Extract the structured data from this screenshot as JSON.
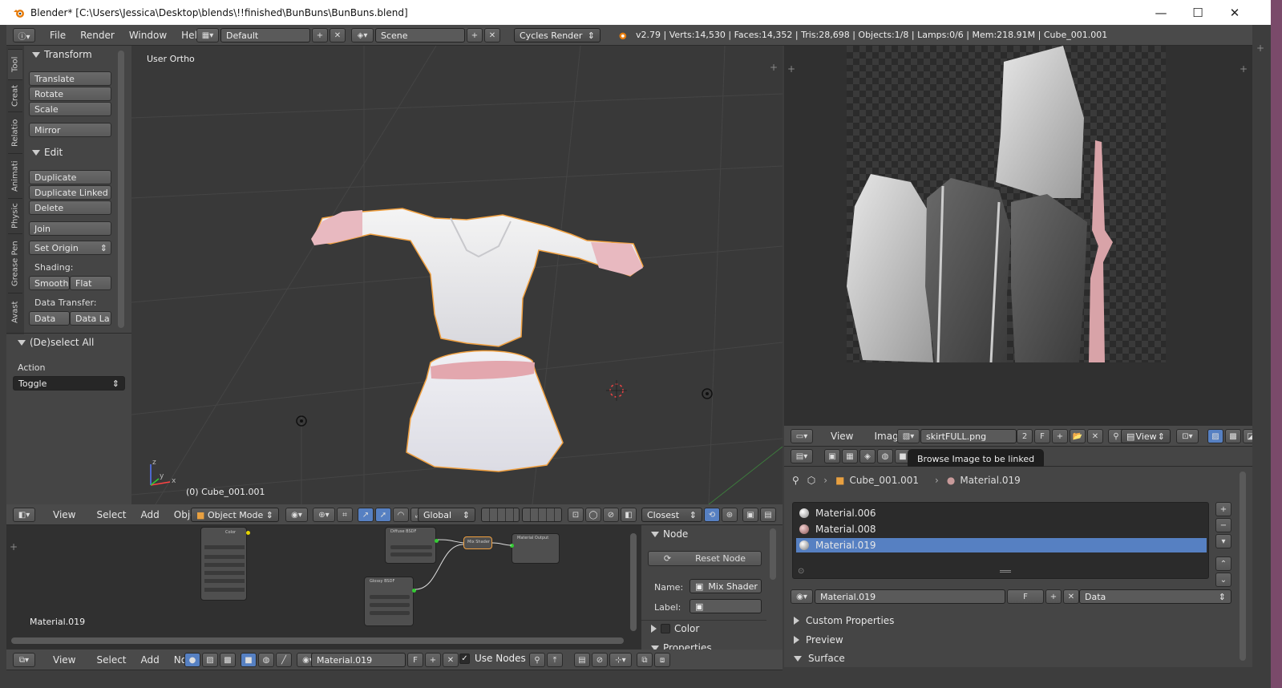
{
  "window": {
    "title": "Blender* [C:\\Users\\Jessica\\Desktop\\blends\\!!finished\\BunBuns\\BunBuns.blend]",
    "minimize_glyph": "—",
    "maximize_glyph": "☐",
    "close_glyph": "✕"
  },
  "info_header": {
    "menus": [
      "File",
      "Render",
      "Window",
      "Help"
    ],
    "layout": "Default",
    "scene": "Scene",
    "engine": "Cycles Render",
    "stats": "v2.79 | Verts:14,530 | Faces:14,352 | Tris:28,698 | Objects:1/8 | Lamps:0/6 | Mem:218.91M | Cube_001.001"
  },
  "toolshelf": {
    "tabs": [
      "Tool",
      "Creat",
      "Relatio",
      "Animati",
      "Physic",
      "Grease Pen",
      "Avast"
    ],
    "transform_title": "Transform",
    "translate": "Translate",
    "rotate": "Rotate",
    "scale": "Scale",
    "mirror": "Mirror",
    "edit_title": "Edit",
    "duplicate": "Duplicate",
    "duplicate_linked": "Duplicate Linked",
    "delete": "Delete",
    "join": "Join",
    "set_origin": "Set Origin",
    "shading_label": "Shading:",
    "smooth": "Smooth",
    "flat": "Flat",
    "data_transfer_label": "Data Transfer:",
    "data": "Data",
    "data_la": "Data La",
    "deselect_title": "(De)select All",
    "action_label": "Action",
    "action_value": "Toggle"
  },
  "viewport": {
    "view_name": "User Ortho",
    "object_label": "(0) Cube_001.001",
    "axis_x": "x",
    "axis_y": "y",
    "axis_z": "z"
  },
  "viewport_header": {
    "menus": [
      "View",
      "Select",
      "Add",
      "Object"
    ],
    "mode": "Object Mode",
    "orientation": "Global",
    "snap": "Closest"
  },
  "image_editor": {
    "menus": [
      "View",
      "Image"
    ],
    "image_name": "skirtFULL.png",
    "users": "2",
    "fake": "F",
    "view_dropdown": "View"
  },
  "tooltip": "Browse Image to be linked",
  "properties": {
    "breadcrumb_object": "Cube_001.001",
    "breadcrumb_material": "Material.019",
    "materials": [
      {
        "name": "Material.006",
        "color": "#bdbdbd",
        "selected": false
      },
      {
        "name": "Material.008",
        "color": "#c9a0a0",
        "selected": false
      },
      {
        "name": "Material.019",
        "color": "#c5c5c5",
        "selected": true
      }
    ],
    "material_field": "Material.019",
    "fake": "F",
    "link": "Data",
    "sections": [
      "Custom Properties",
      "Preview",
      "Surface"
    ]
  },
  "node_editor": {
    "material_label": "Material.019",
    "node_labels": {
      "diffuse": "Diffuse BSDF",
      "glossy": "Glossy BSDF",
      "mix": "Mix Shader",
      "output": "Material Output",
      "image": "Color"
    }
  },
  "node_panel": {
    "node_title": "Node",
    "reset_node": "Reset Node",
    "name_label": "Name:",
    "name_value": "Mix Shader",
    "label_label": "Label:",
    "color_section": "Color",
    "properties_section": "Properties"
  },
  "node_header": {
    "menus": [
      "View",
      "Select",
      "Add",
      "Node"
    ],
    "material": "Material.019",
    "fake": "F",
    "use_nodes": "Use Nodes"
  },
  "colors": {
    "selection": "#5680c2",
    "outline": "#f0a040",
    "panel": "#454545",
    "header": "#4a4a4a"
  }
}
